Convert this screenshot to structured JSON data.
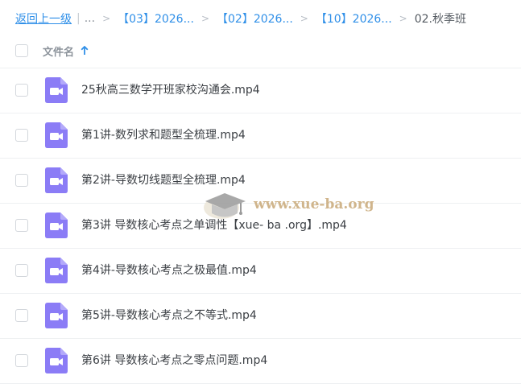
{
  "breadcrumb": {
    "back": "返回上一级",
    "ellipsis": "...",
    "items": [
      "【03】2026...",
      "【02】2026...",
      "【10】2026..."
    ],
    "current": "02.秋季班"
  },
  "header": {
    "column_name": "文件名"
  },
  "files": [
    {
      "name": "25秋高三数学开班家校沟通会.mp4",
      "type": "video-icon"
    },
    {
      "name": "第1讲-数列求和题型全梳理.mp4",
      "type": "video-icon"
    },
    {
      "name": "第2讲-导数切线题型全梳理.mp4",
      "type": "video-icon"
    },
    {
      "name": "第3讲 导数核心考点之单调性【xue- ba .org】.mp4",
      "type": "video-icon"
    },
    {
      "name": "第4讲-导数核心考点之极最值.mp4",
      "type": "video-icon"
    },
    {
      "name": "第5讲-导数核心考点之不等式.mp4",
      "type": "video-icon"
    },
    {
      "name": "第6讲 导数核心考点之零点问题.mp4",
      "type": "video-icon"
    }
  ],
  "watermark": {
    "text": "www.xue-ba.org"
  },
  "colors": {
    "link": "#2f8fe8",
    "video_icon": "#8b7cf6",
    "watermark": "#c8a878"
  }
}
